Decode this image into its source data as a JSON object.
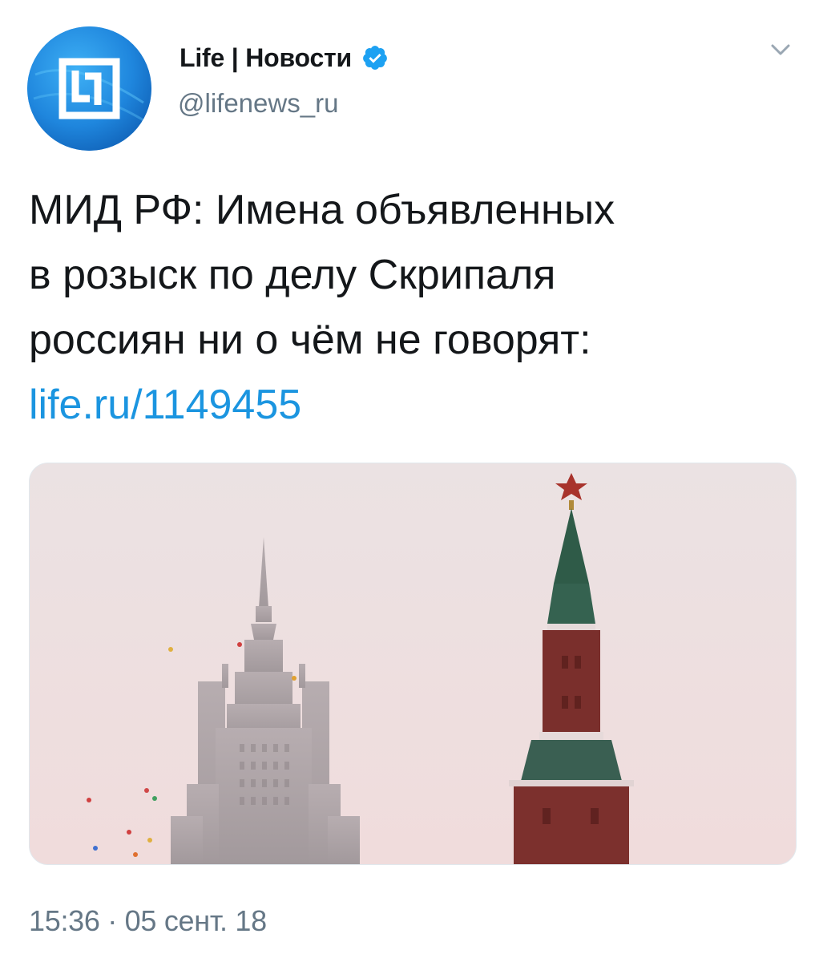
{
  "account": {
    "name": "Life | Новости",
    "handle": "@lifenews_ru",
    "verified": true,
    "avatar_icon": "life-logo-icon",
    "avatar_color": "#1f86dd"
  },
  "menu": {
    "icon": "chevron-down-icon"
  },
  "tweet": {
    "text_lines": [
      "МИД РФ: Имена объявленных",
      "в розыск по делу Скрипаля",
      "россиян ни о чём не говорят:"
    ],
    "link": "life.ru/1149455",
    "link_color": "#1b95e0"
  },
  "media": {
    "type": "photo",
    "subject_icon": "moscow-towers-photo"
  },
  "footer": {
    "timestamp": "15:36 · 05 сент. 18"
  }
}
